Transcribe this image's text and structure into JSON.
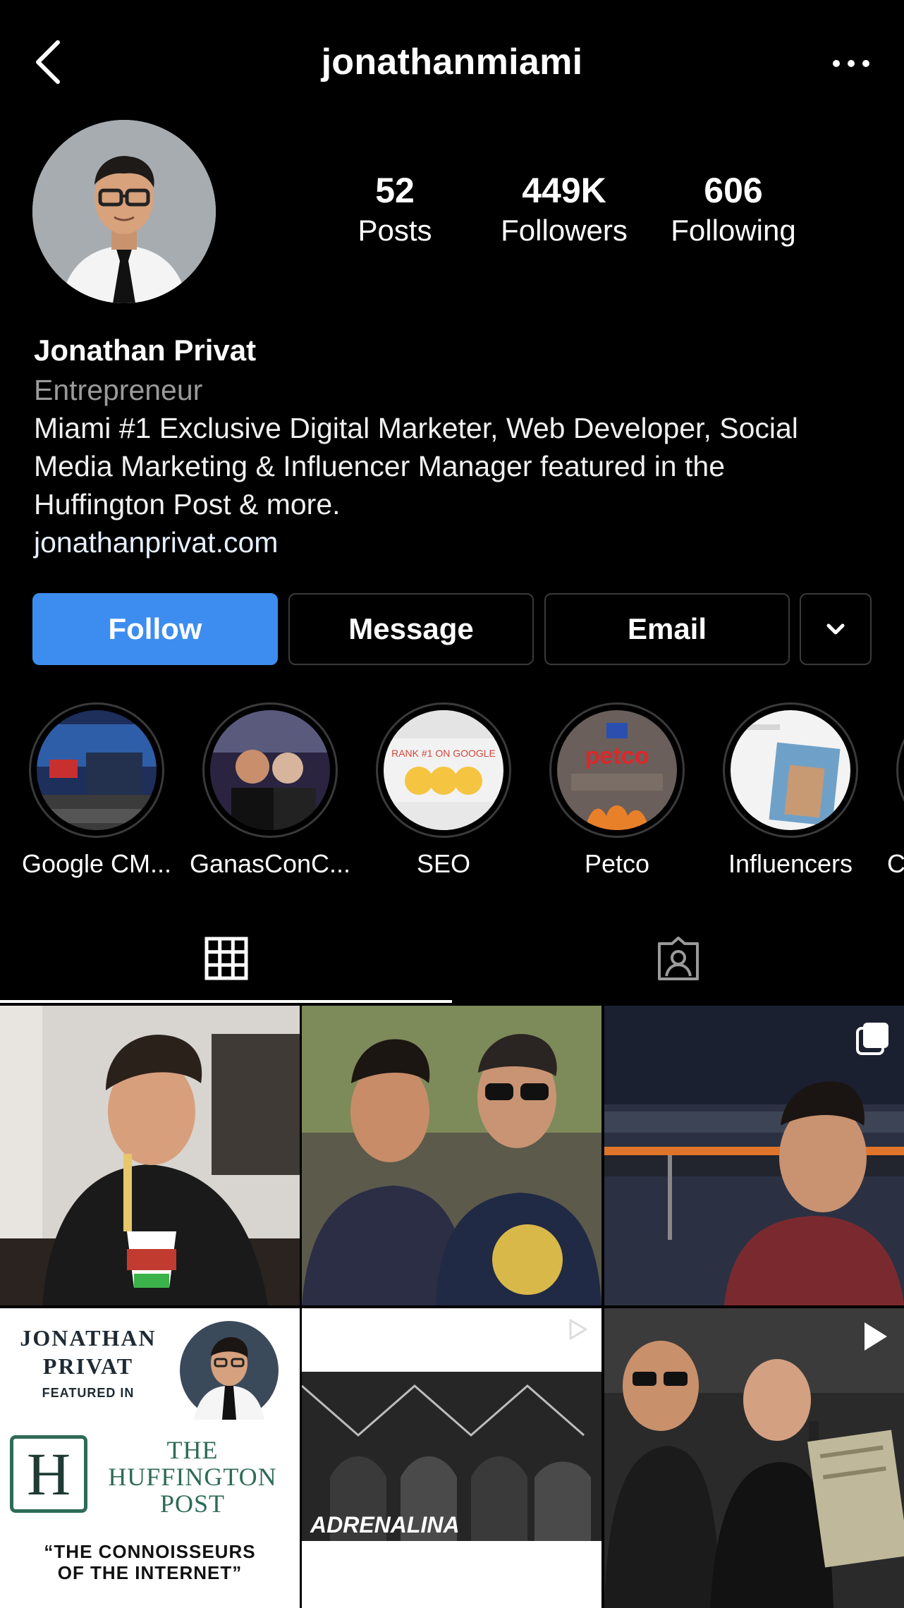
{
  "header": {
    "username": "jonathanmiami",
    "back_icon": "chevron-left-icon",
    "more_icon": "more-horizontal-icon"
  },
  "stats": {
    "posts": {
      "value": "52",
      "label": "Posts"
    },
    "followers": {
      "value": "449K",
      "label": "Followers"
    },
    "following": {
      "value": "606",
      "label": "Following"
    }
  },
  "bio": {
    "name": "Jonathan Privat",
    "category": "Entrepreneur",
    "lines": [
      "Miami #1 Exclusive Digital Marketer, Web Developer, Social",
      "Media Marketing & Influencer Manager featured in the",
      "Huffington Post & more."
    ],
    "link": "jonathanprivat.com"
  },
  "actions": {
    "follow": "Follow",
    "message": "Message",
    "email": "Email",
    "dropdown_icon": "chevron-down-icon"
  },
  "highlights": [
    {
      "label": "Google CM..."
    },
    {
      "label": "GanasConC..."
    },
    {
      "label": "SEO",
      "cover_text": "RANK #1 ON GOOGLE"
    },
    {
      "label": "Petco",
      "cover_text": "petco"
    },
    {
      "label": "Influencers"
    },
    {
      "label": "C"
    }
  ],
  "tabs": [
    {
      "name": "grid-icon"
    },
    {
      "name": "tagged-icon"
    }
  ],
  "posts": {
    "huffpost": {
      "line1": "JONATHAN",
      "line2": "PRIVAT",
      "featured": "FEATURED IN",
      "the": "THE",
      "huffington": "HUFFINGTON",
      "post": "POST",
      "quote1": "“THE CONNOISSEURS",
      "quote2": "OF THE INTERNET”"
    },
    "adrenalina": "ADRENALINA"
  },
  "colors": {
    "follow_button": "#3d8df0",
    "background": "#000000",
    "muted_text": "#9a9a9a",
    "huffpost_green": "#2e6b55"
  }
}
